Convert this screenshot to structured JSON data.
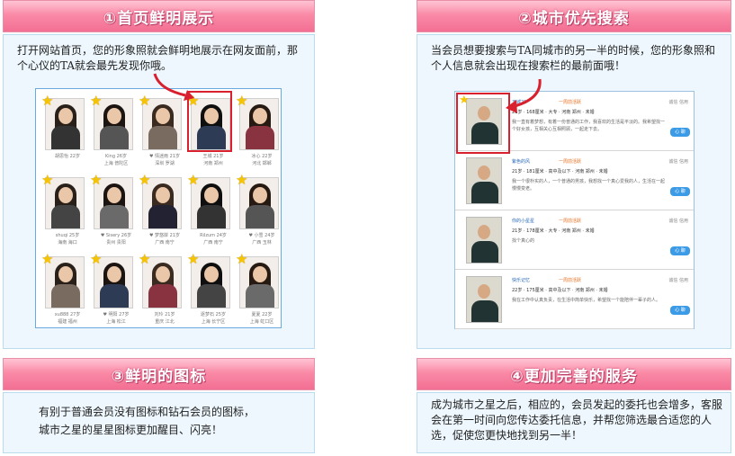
{
  "panels": [
    {
      "title": "①首页鲜明展示",
      "description": "打开网站首页，您的形象照就会鲜明地展示在网友面前，那个心仪的TA就会最先发现你哦。"
    },
    {
      "title": "②城市优先搜索",
      "description": "当会员想要搜索与TA同城市的另一半的时候，您的形象照和个人信息就会出现在搜索栏的最前面哦！"
    },
    {
      "title": "③鲜明的图标",
      "description_lines": [
        "有别于普通会员没有图标和钻石会员的图标，",
        "城市之星的星星图标更加醒目、闪亮！"
      ]
    },
    {
      "title": "④更加完善的服务",
      "description": "成为城市之星之后，相应的，会员发起的委托也会增多，客服会在第一时间向您传达委托信息，并帮您筛选最合适您的人选，促使您更快地找到另一半！"
    }
  ],
  "grid_cells": [
    {
      "caption1": "胡思怡 22岁",
      "caption2": ""
    },
    {
      "caption1": "King 26岁",
      "caption2": "上海 普陀区"
    },
    {
      "caption1": "♥ 情迷雨 21岁",
      "caption2": "深圳 罗湖"
    },
    {
      "caption1": "王城 21岁",
      "caption2": "河南 郑州"
    },
    {
      "caption1": "冰心 22岁",
      "caption2": "河北 邯郸"
    },
    {
      "caption1": "shuqi 25岁",
      "caption2": "海南 海口"
    },
    {
      "caption1": "♥ Sisery 26岁",
      "caption2": "贵州 贵阳"
    },
    {
      "caption1": "♥ 梦悠岸 21岁",
      "caption2": "广西 南宁"
    },
    {
      "caption1": "Rilzum 24岁",
      "caption2": "广西 南宁"
    },
    {
      "caption1": "♥ 小雪 24岁",
      "caption2": "广西 玉林"
    },
    {
      "caption1": "xu888 27岁",
      "caption2": "福建 福州"
    },
    {
      "caption1": "♥ 明阳 27岁",
      "caption2": "上海 松江"
    },
    {
      "caption1": "刘玲 21岁",
      "caption2": "重庆 江北"
    },
    {
      "caption1": "逐梦石 25岁",
      "caption2": "上海 长宁区"
    },
    {
      "caption1": "夏夏 22岁",
      "caption2": "上海 虹口区"
    }
  ],
  "list_rows": [
    {
      "name": "王城21",
      "tag": "一周前活跃",
      "info": "21岁 · 168厘米 · 大专 · 河南 郑州 · 未婚",
      "text": "我一直有着梦想，有着一份普通的工作，我喜欢的生活是平淡的。我希望找一个好女孩，互相关心互相照顾，一起走下去。",
      "stat": "诚信 信用",
      "button": "心 聊"
    },
    {
      "name": "紫色的风",
      "tag": "一周前活跃",
      "info": "21岁 · 181厘米 · 高中及以下 · 河南 郑州 · 未婚",
      "text": "我一个很朴实的人，一个普通的男孩，我想找一个真心爱我的人，生活在一起慢慢变老。",
      "stat": "诚信 信用",
      "button": "心 聊"
    },
    {
      "name": "你的小星星",
      "tag": "一周前活跃",
      "info": "21岁 · 178厘米 · 大专 · 河南 郑州 · 未婚",
      "text": "找个真心的",
      "stat": "诚信 信用",
      "button": "心 聊"
    },
    {
      "name": "快乐记忆",
      "tag": "一周前活跃",
      "info": "22岁 · 175厘米 · 高中及以下 · 河南 郑州 · 未婚",
      "text": "我在工作中认真负责，在生活中简单快乐，希望找一个能陪伴一辈子的人。",
      "stat": "诚信 信用",
      "button": "心 聊"
    }
  ],
  "colors": {
    "banner_top": "#ffc4d4",
    "banner_bottom": "#f26f93",
    "body_bg": "#edf7fd",
    "highlight": "#d8202e",
    "star": "#f6c400"
  }
}
